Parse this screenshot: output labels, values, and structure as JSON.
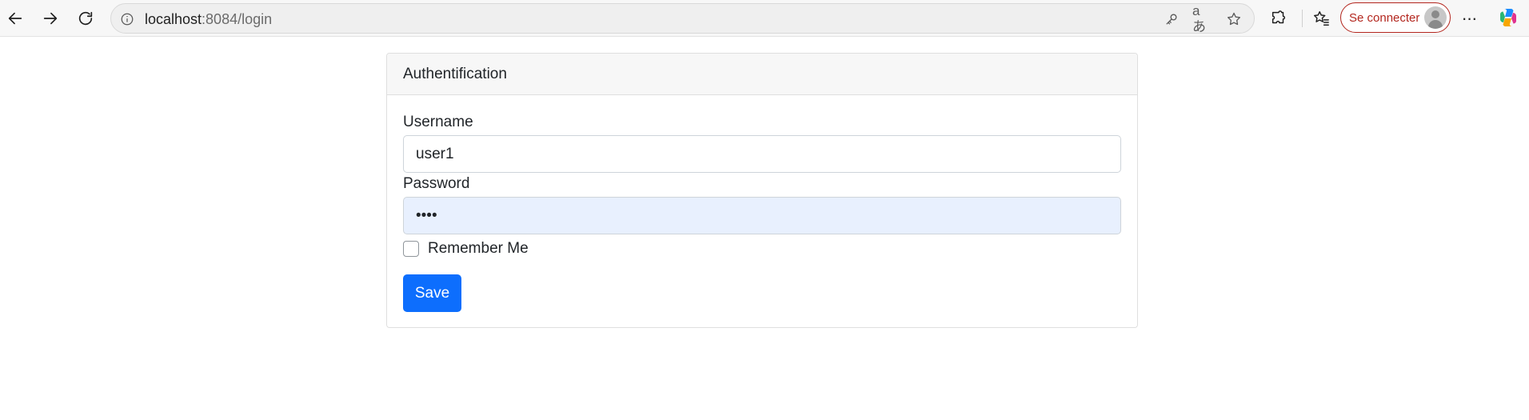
{
  "browser": {
    "address": {
      "host": "localhost",
      "path": ":8084/login"
    },
    "translate_glyph": "aあ",
    "signin_label": "Se connecter",
    "menu_glyph": "···",
    "icons": [
      "back-icon",
      "forward-icon",
      "refresh-icon",
      "site-info-icon",
      "key-icon",
      "translate-icon",
      "favorite-star-icon",
      "extensions-icon",
      "favorites-icon",
      "avatar-icon",
      "more-icon",
      "copilot-icon"
    ]
  },
  "card": {
    "title": "Authentification",
    "username": {
      "label": "Username",
      "value": "user1"
    },
    "password": {
      "label": "Password",
      "value": "••••"
    },
    "remember_label": "Remember Me",
    "remember_checked": false,
    "submit_label": "Save"
  },
  "colors": {
    "primary_button": "#0d6efd",
    "autofill_bg": "#e8f0fe",
    "signin_accent": "#b3261e"
  }
}
